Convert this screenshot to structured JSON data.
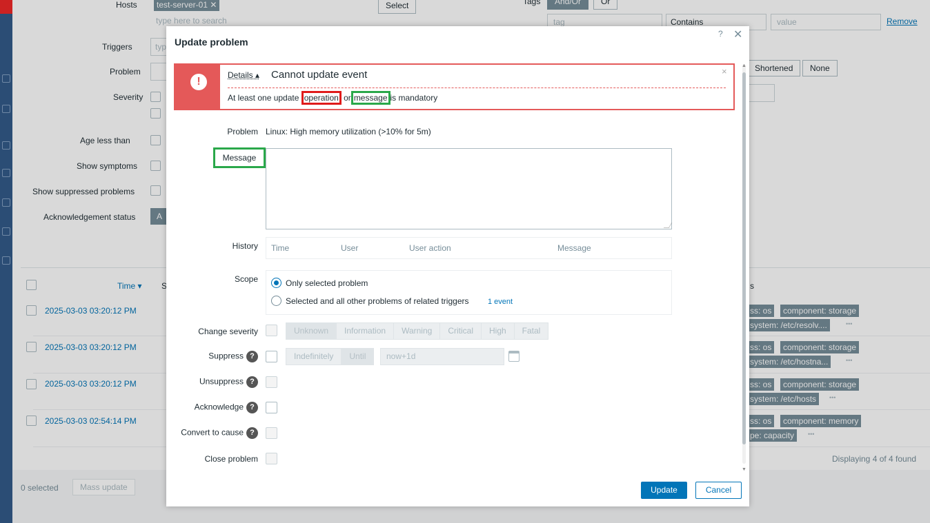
{
  "background": {
    "filter": {
      "hosts_label": "Hosts",
      "host_chip": "test-server-01 ✕",
      "hosts_placeholder": "type here to search",
      "select_button": "Select",
      "tags_label": "Tags",
      "tags_andor": "And/Or",
      "tags_or": "Or",
      "tag_placeholder": "tag",
      "tag_operator": "Contains",
      "value_placeholder": "value",
      "remove_link": "Remove",
      "triggers_label": "Triggers",
      "triggers_placeholder": "typ",
      "problem_label": "Problem",
      "severity_label": "Severity",
      "age_label": "Age less than",
      "show_symptoms_label": "Show symptoms",
      "show_suppressed_label": "Show suppressed problems",
      "ack_status_label": "Acknowledgement status",
      "ack_button_fragment": "A",
      "shortened_button": "Shortened",
      "none_button": "None"
    },
    "list": {
      "time_header": "Time ▾",
      "status_header_fragment": "S",
      "tags_header_fragment": "s",
      "rows": [
        {
          "time": "2025-03-03 03:20:12 PM",
          "tag1": "ss: os",
          "tag2": "component: storage",
          "tag3": "system: /etc/resolv...."
        },
        {
          "time": "2025-03-03 03:20:12 PM",
          "tag1": "ss: os",
          "tag2": "component: storage",
          "tag3": "system: /etc/hostna..."
        },
        {
          "time": "2025-03-03 03:20:12 PM",
          "tag1": "ss: os",
          "tag2": "component: storage",
          "tag3": "system: /etc/hosts"
        },
        {
          "time": "2025-03-03 02:54:14 PM",
          "tag1": "ss: os",
          "tag2": "component: memory",
          "tag3": "pe: capacity"
        }
      ],
      "more_glyph": "•••",
      "displaying": "Displaying 4 of 4 found",
      "selected_count": "0 selected",
      "mass_update": "Mass update"
    }
  },
  "modal": {
    "title": "Update problem",
    "help_glyph": "?",
    "close_glyph": "✕",
    "error": {
      "icon_glyph": "!",
      "details_link": "Details ▴",
      "title": "Cannot update event",
      "close_glyph": "×",
      "msg_pre": "At least one update ",
      "msg_operation": "operation",
      "msg_mid": " or",
      "msg_message": "message",
      "msg_post": "is mandatory"
    },
    "problem_label": "Problem",
    "problem_value": "Linux: High memory utilization (>10% for 5m)",
    "message_label": "Message",
    "history_label": "History",
    "history_columns": [
      "Time",
      "User",
      "User action",
      "Message"
    ],
    "scope_label": "Scope",
    "scope_option1": "Only selected problem",
    "scope_option2": "Selected and all other problems of related triggers",
    "scope_option2_count": "1 event",
    "change_severity_label": "Change severity",
    "severities": [
      "Unknown",
      "Information",
      "Warning",
      "Critical",
      "High",
      "Fatal"
    ],
    "suppress_label": "Suppress",
    "suppress_options": [
      "Indefinitely",
      "Until"
    ],
    "suppress_until_value": "now+1d",
    "unsuppress_label": "Unsuppress",
    "acknowledge_label": "Acknowledge",
    "convert_label": "Convert to cause",
    "close_problem_label": "Close problem",
    "help_icon_glyph": "?",
    "update_button": "Update",
    "cancel_button": "Cancel"
  }
}
